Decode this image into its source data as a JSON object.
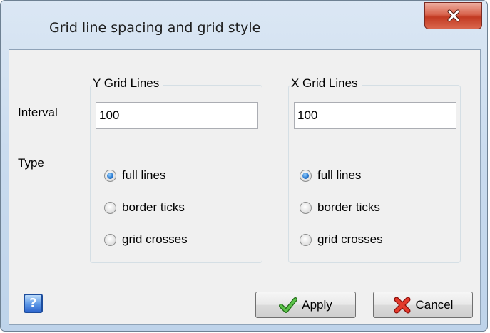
{
  "window": {
    "title": "Grid line spacing and grid style"
  },
  "close_button": {
    "icon": "close-icon"
  },
  "labels": {
    "interval": "Interval",
    "type": "Type"
  },
  "y_grid": {
    "title": "Y Grid Lines",
    "interval": "100",
    "options": [
      {
        "label": "full lines",
        "checked": true
      },
      {
        "label": "border ticks",
        "checked": false
      },
      {
        "label": "grid crosses",
        "checked": false
      }
    ]
  },
  "x_grid": {
    "title": "X Grid Lines",
    "interval": "100",
    "options": [
      {
        "label": "full lines",
        "checked": true
      },
      {
        "label": "border ticks",
        "checked": false
      },
      {
        "label": "grid crosses",
        "checked": false
      }
    ]
  },
  "footer": {
    "help_icon": "help-icon",
    "help_text": "?",
    "apply_label": "Apply",
    "apply_icon": "checkmark-icon",
    "cancel_label": "Cancel",
    "cancel_icon": "cross-icon"
  },
  "colors": {
    "close_button": "#c9422a",
    "selected_radio": "#2a7ad1",
    "checkmark": "#3aa229",
    "cross": "#d9251d"
  }
}
